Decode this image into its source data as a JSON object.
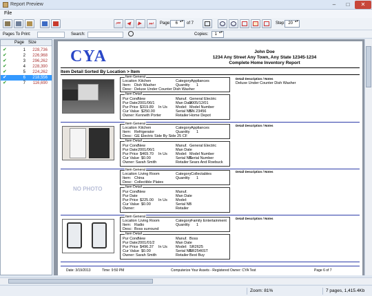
{
  "window": {
    "title": "Report Preview"
  },
  "menu": {
    "file": "File"
  },
  "toolbar": {
    "page_label": "Page:",
    "page_value": "6",
    "page_of": "of 7",
    "step_label": "Step:",
    "step_value": "20"
  },
  "searchbar": {
    "pages_to_print_label": "Pages To Print:",
    "search_label": "Search:",
    "copies_label": "Copies:",
    "copies_value": "1"
  },
  "pagelist": {
    "col_page": "Page",
    "col_size": "Size",
    "selected_index": 5,
    "rows": [
      {
        "page": "1",
        "size": "228,736"
      },
      {
        "page": "2",
        "size": "226,968"
      },
      {
        "page": "3",
        "size": "296,262"
      },
      {
        "page": "4",
        "size": "228,390"
      },
      {
        "page": "5",
        "size": "224,262"
      },
      {
        "page": "6",
        "size": "218,556"
      },
      {
        "page": "7",
        "size": "116,690"
      }
    ]
  },
  "report": {
    "logo_text": "CYA",
    "owner_name": "John Doe",
    "address": "1234 Any Street  Any Town, Any State  12345-1234",
    "report_title": "Complete Home Inventory Report",
    "section_title": "Item Detail Sorted By Location > Item",
    "general_caption": "Item General",
    "detail_caption": "Item Detail",
    "desc_label": "Detail Description / Notes",
    "no_photo_text": "NO PHOTO",
    "items": [
      {
        "location": "Kitchen",
        "category": "Appliances",
        "item": "Dish Washer",
        "quantity": "1",
        "desc": "Deluxe Under Counter Dish Washer",
        "pur_cond": "New",
        "pur_date": "2001/06/1",
        "pur_price": "$319.89",
        "in_us": "In Us",
        "cur_value": "$250.00",
        "owner": "Kenneth Porter",
        "manuf": "General Electric",
        "man_date": "2005/12/01",
        "model": "Model Number",
        "serial": "SN 23456",
        "retailer": "Home Depot",
        "notes": "Deluxe Under Counter Dish Washer"
      },
      {
        "location": "Kitchen",
        "category": "Appliances",
        "item": "Refrigerator",
        "quantity": "1",
        "desc": "GE Electric Side By Side 25 CF",
        "pur_cond": "New",
        "pur_date": "2001/06/1",
        "pur_price": "$469.70",
        "in_us": "In Us",
        "cur_value": "$0.00",
        "owner": "Sarah Smith",
        "manuf": "General Electric",
        "man_date": "",
        "model": "Model Number",
        "serial": "Serial Number",
        "retailer": "Sears And Roebuck",
        "notes": ""
      },
      {
        "location": "Living Room",
        "category": "Collectables",
        "item": "China",
        "quantity": "1",
        "desc": "Collectible Plates",
        "pur_cond": "New",
        "pur_date": "",
        "pur_price": "$225.00",
        "in_us": "In Us",
        "cur_value": "$0.00",
        "owner": "",
        "manuf": "",
        "man_date": "",
        "model": "",
        "serial": "",
        "retailer": "",
        "notes": ""
      },
      {
        "location": "Living Room",
        "category": "Family Entertainment",
        "item": "Radio",
        "quantity": "1",
        "desc": "Boss surround",
        "pur_cond": "New",
        "pur_date": "2001/01/2",
        "pur_price": "$496.37",
        "in_us": "In Us",
        "cur_value": "$0.00",
        "owner": "Sarah Smith",
        "manuf": "Boss",
        "man_date": "",
        "model": "SR2625",
        "serial": "SR2546ST",
        "retailer": "Best Buy",
        "notes": ""
      }
    ],
    "field_labels": {
      "location": "Location",
      "category": "Category",
      "item": "Item:",
      "quantity": "Quantity",
      "desc": "Desc:",
      "pur_cond": "Pur Cond",
      "pur_date": "Pur Date",
      "pur_price": "Pur Price",
      "cur_value": "Cur Value",
      "owner": "Owner:",
      "manuf": "Manuf.",
      "man_date": "Man Date",
      "model": "Model:",
      "serial": "Serial NB",
      "retailer": "Retailer"
    },
    "footer": {
      "date": "Date: 3/19/2013",
      "time": "Time: 9:50 PM",
      "center": "Computerize Your Assets - Registered Owner: CYA Test",
      "page": "Page   6 of 7"
    }
  },
  "status": {
    "zoom": "Zoom: 81%",
    "pages": "7 pages, 1,415.4Kb"
  }
}
